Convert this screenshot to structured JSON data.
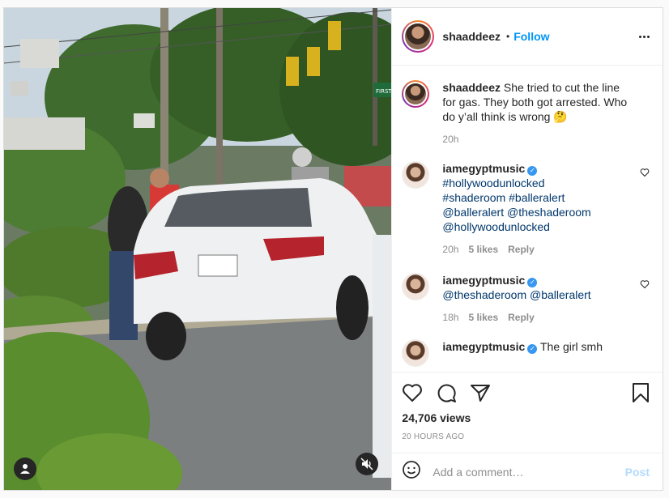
{
  "post": {
    "username": "shaaddeez",
    "follow_label": "Follow",
    "separator": "•",
    "caption": {
      "username": "shaaddeez",
      "text": "She tried to cut the line for gas. They both got arrested. Who do y’all think is wrong 🤔",
      "time": "20h"
    },
    "comments": [
      {
        "username": "iamegyptmusic",
        "verified": true,
        "lines": [
          "#hollywoodunlocked",
          "#shaderoom #balleralert",
          "@balleralert @theshaderoom",
          "@hollywoodunlocked"
        ],
        "time": "20h",
        "likes": "5 likes",
        "reply": "Reply"
      },
      {
        "username": "iamegyptmusic",
        "verified": true,
        "lines": [
          "@theshaderoom @balleralert"
        ],
        "time": "18h",
        "likes": "5 likes",
        "reply": "Reply"
      },
      {
        "username": "iamegyptmusic",
        "verified": true,
        "text": "The girl smh"
      }
    ],
    "views": "24,706 views",
    "timestamp": "20 HOURS AGO",
    "add_comment_placeholder": "Add a comment…",
    "post_button": "Post",
    "street_sign": "FIRST"
  },
  "icons": {
    "like": "heart-icon",
    "comment": "comment-icon",
    "share": "share-icon",
    "save": "bookmark-icon",
    "emoji": "emoji-icon",
    "more": "more-options-icon",
    "tag": "user-tag-icon",
    "mute": "muted-speaker-icon"
  },
  "colors": {
    "accent": "#0095f6",
    "verified": "#3897f0",
    "muted_text": "#8e8e8e",
    "post_disabled": "#b3dbff"
  }
}
